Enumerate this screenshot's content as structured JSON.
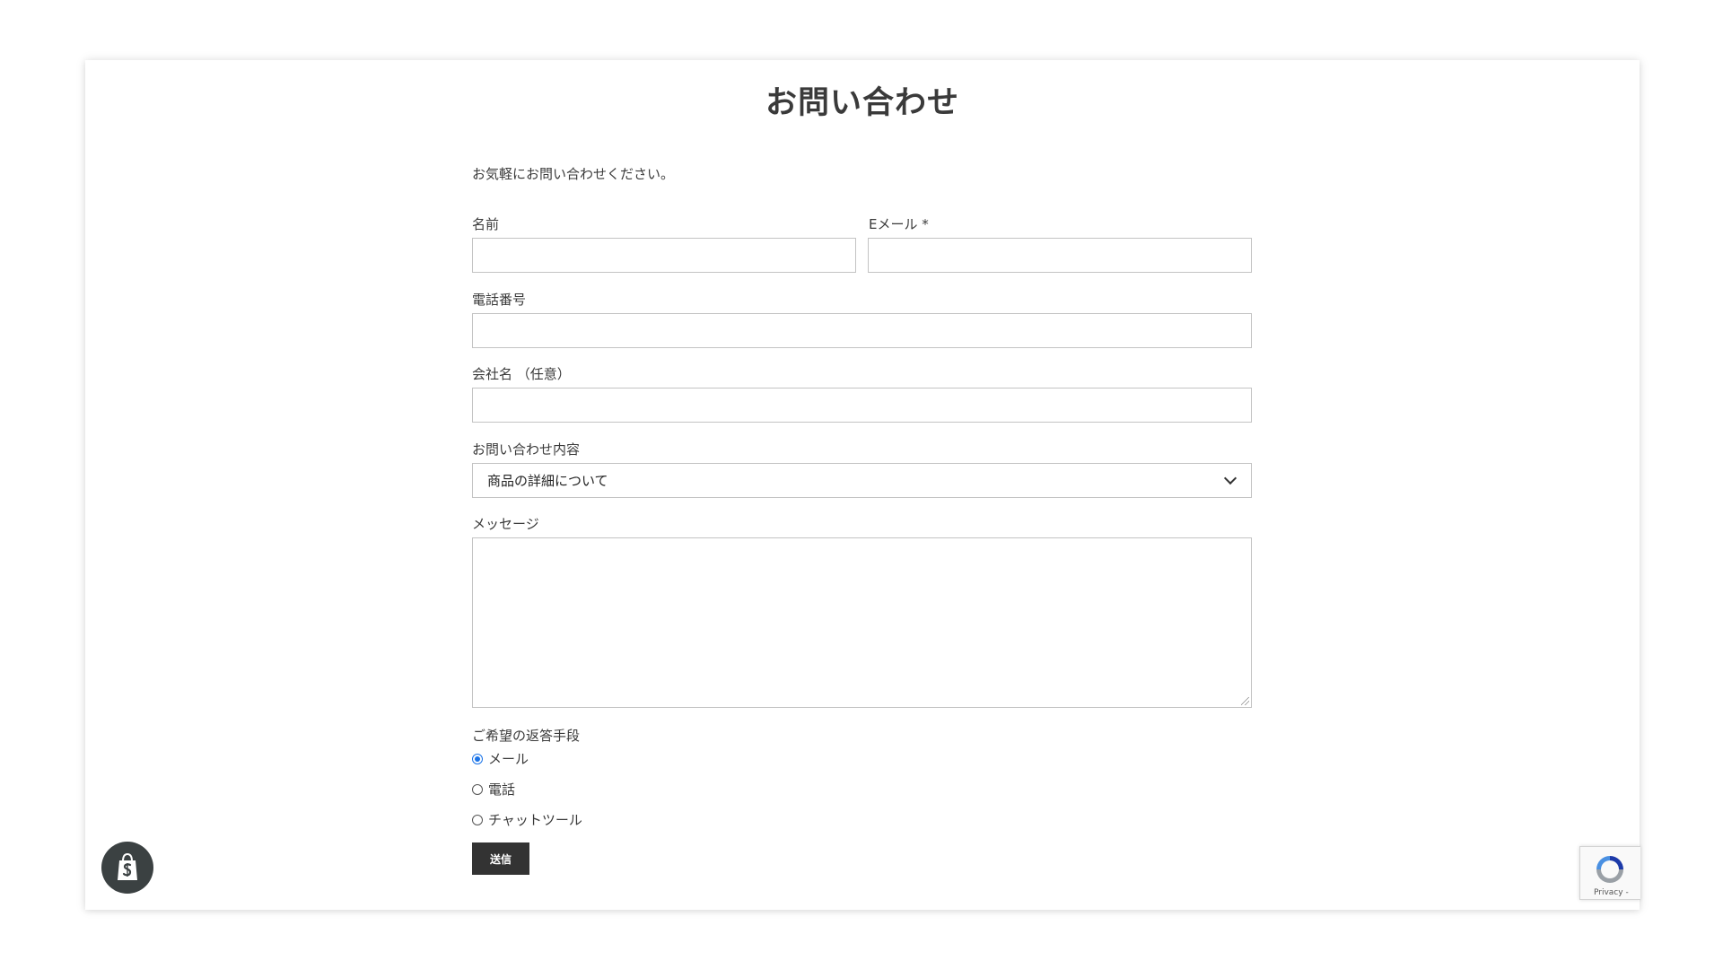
{
  "page": {
    "title": "お問い合わせ",
    "intro": "お気軽にお問い合わせください。"
  },
  "form": {
    "name_label": "名前",
    "email_label": "Eメール *",
    "phone_label": "電話番号",
    "company_label": "会社名 （任意）",
    "inquiry_label": "お問い合わせ内容",
    "inquiry_selected": "商品の詳細について",
    "message_label": "メッセージ",
    "reply_label": "ご希望の返答手段",
    "reply_options": [
      {
        "label": "メール",
        "checked": true
      },
      {
        "label": "電話",
        "checked": false
      },
      {
        "label": "チャットツール",
        "checked": false
      }
    ],
    "submit_label": "送信"
  },
  "badges": {
    "shopify_icon": "shopify-bag-icon",
    "recaptcha_text": "Privacy -",
    "recaptcha_icon": "recaptcha-icon"
  },
  "colors": {
    "accent": "#1a73e8",
    "button_bg": "#333333",
    "badge_bg": "#3b4142"
  }
}
